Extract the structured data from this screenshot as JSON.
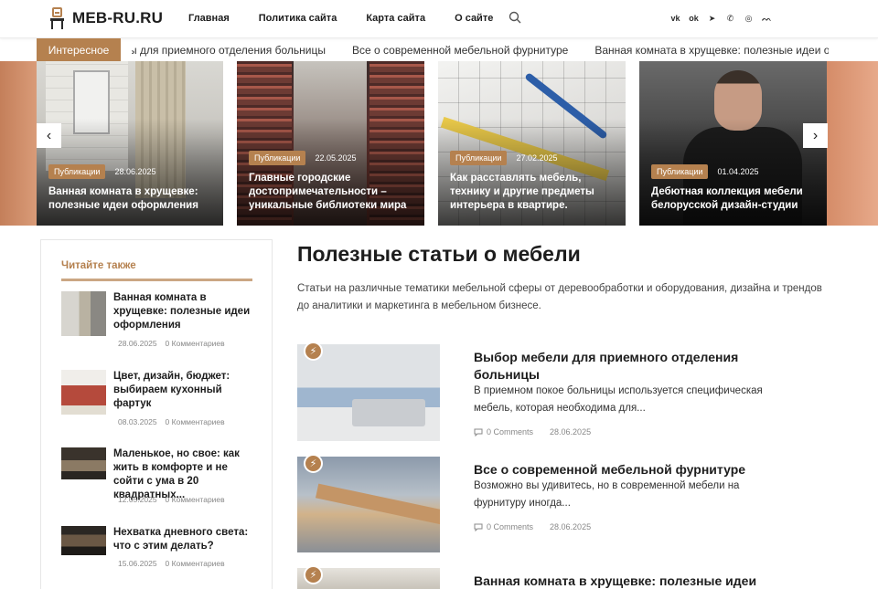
{
  "header": {
    "logo_text": "MEB-RU.RU",
    "nav": [
      "Главная",
      "Политика сайта",
      "Карта сайта",
      "О сайте"
    ],
    "socials": [
      {
        "name": "vk-icon",
        "glyph": "vk"
      },
      {
        "name": "odnoklassniki-icon",
        "glyph": "ok"
      },
      {
        "name": "telegram-icon",
        "glyph": "➤"
      },
      {
        "name": "viber-icon",
        "glyph": "✆"
      },
      {
        "name": "whatsapp-icon",
        "glyph": "◎"
      },
      {
        "name": "rss-icon",
        "glyph": "ᨓ"
      }
    ]
  },
  "ticker": {
    "label": "Интересное",
    "items": [
      "ы для приемного отделения больницы",
      "Все о современной мебельной фурнитуре",
      "Ванная комната в хрущевке: полезные идеи офор"
    ]
  },
  "slider": {
    "slides": [
      {
        "badge": "Публикации",
        "date": "28.06.2025",
        "title": "Ванная комната в хрущевке: полезные идеи оформления"
      },
      {
        "badge": "Публикации",
        "date": "22.05.2025",
        "title": "Главные городские достопримечательности – уникальные библиотеки мира"
      },
      {
        "badge": "Публикации",
        "date": "27.02.2025",
        "title": "Как расставлять мебель, технику и другие предметы интерьера в квартире."
      },
      {
        "badge": "Публикации",
        "date": "01.04.2025",
        "title": "Дебютная коллекция мебели белорусской дизайн-студии"
      }
    ],
    "prev": "‹",
    "next": "›"
  },
  "sidebar": {
    "title": "Читайте также",
    "items": [
      {
        "title": "Ванная комната в хрущевке: полезные идеи оформления",
        "date": "28.06.2025",
        "comments": "0 Комментариев"
      },
      {
        "title": "Цвет, дизайн, бюджет: выбираем кухонный фартук",
        "date": "08.03.2025",
        "comments": "0 Комментариев"
      },
      {
        "title": "Маленькое, но свое: как жить в комфорте и не сойти с ума в 20 квадратных...",
        "date": "12.05.2025",
        "comments": "0 Комментариев"
      },
      {
        "title": "Нехватка дневного света: что с этим делать?",
        "date": "15.06.2025",
        "comments": "0 Комментариев"
      }
    ]
  },
  "main": {
    "title": "Полезные статьи о мебели",
    "description": "Статьи на различные тематики мебельной сферы от деревообработки и оборудования, дизайна и трендов до аналитики и маркетинга в мебельном бизнесе.",
    "posts": [
      {
        "title": "Выбор мебели для приемного отделения больницы",
        "excerpt": "В приемном покое больницы используется специфическая мебель, которая необходима для...",
        "comments": "0 Comments",
        "date": "28.06.2025"
      },
      {
        "title": "Все о современной мебельной фурнитуре",
        "excerpt": "Возможно вы удивитесь, но в современной мебели на фурнитуру иногда...",
        "comments": "0 Comments",
        "date": "28.06.2025"
      },
      {
        "title": "Ванная комната в хрущевке: полезные идеи",
        "excerpt": "",
        "comments": "",
        "date": ""
      }
    ]
  },
  "colors": {
    "accent": "#b5814f",
    "text": "#1d1d1d",
    "muted": "#888888"
  }
}
